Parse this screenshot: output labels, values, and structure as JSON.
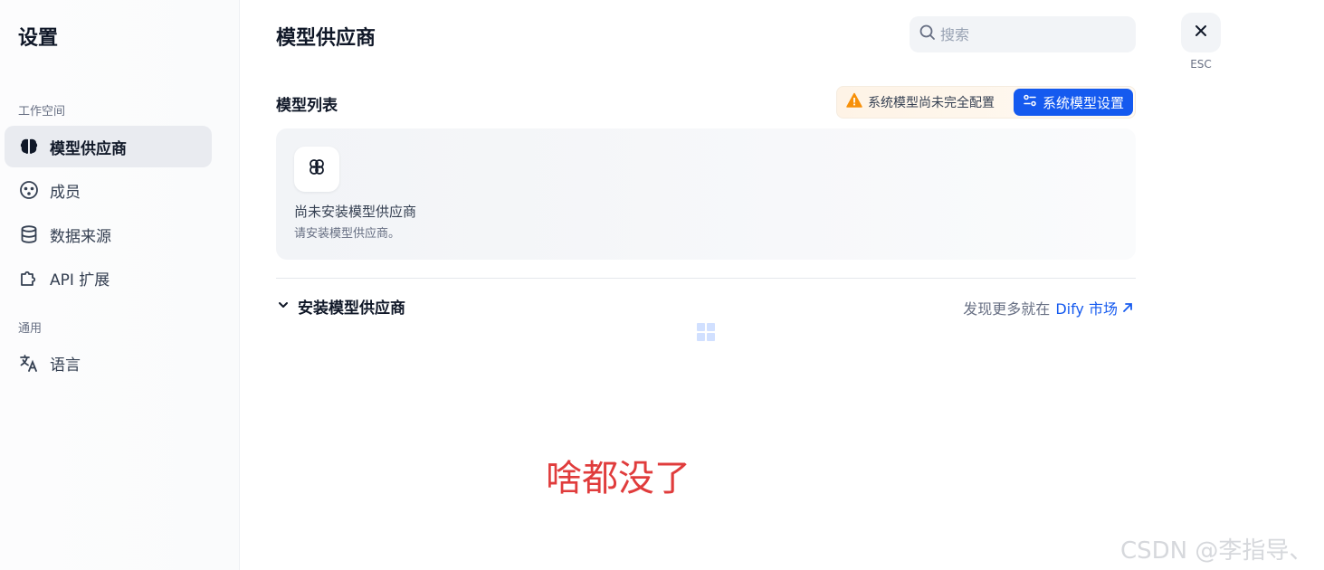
{
  "sidebar": {
    "title": "设置",
    "workspace_group_label": "工作空间",
    "general_group_label": "通用",
    "items": [
      {
        "label": "模型供应商",
        "icon": "brain-icon",
        "active": true
      },
      {
        "label": "成员",
        "icon": "members-icon",
        "active": false
      },
      {
        "label": "数据来源",
        "icon": "database-icon",
        "active": false
      },
      {
        "label": "API 扩展",
        "icon": "puzzle-icon",
        "active": false
      }
    ],
    "general_items": [
      {
        "label": "语言",
        "icon": "translate-icon",
        "active": false
      }
    ]
  },
  "header": {
    "title": "模型供应商",
    "search_placeholder": "搜索"
  },
  "model_list": {
    "title": "模型列表",
    "warning_text": "系统模型尚未完全配置",
    "system_model_button": "系统模型设置",
    "empty_title": "尚未安装模型供应商",
    "empty_subtitle": "请安装模型供应商。"
  },
  "install": {
    "title": "安装模型供应商",
    "discover_text": "发现更多就在",
    "marketplace_link": "Dify 市场"
  },
  "close": {
    "esc_label": "ESC"
  },
  "annotation": "啥都没了",
  "watermark": "CSDN @李指导、",
  "colors": {
    "primary": "#155aef",
    "warning": "#f79009",
    "annotation": "#e03c3c"
  }
}
